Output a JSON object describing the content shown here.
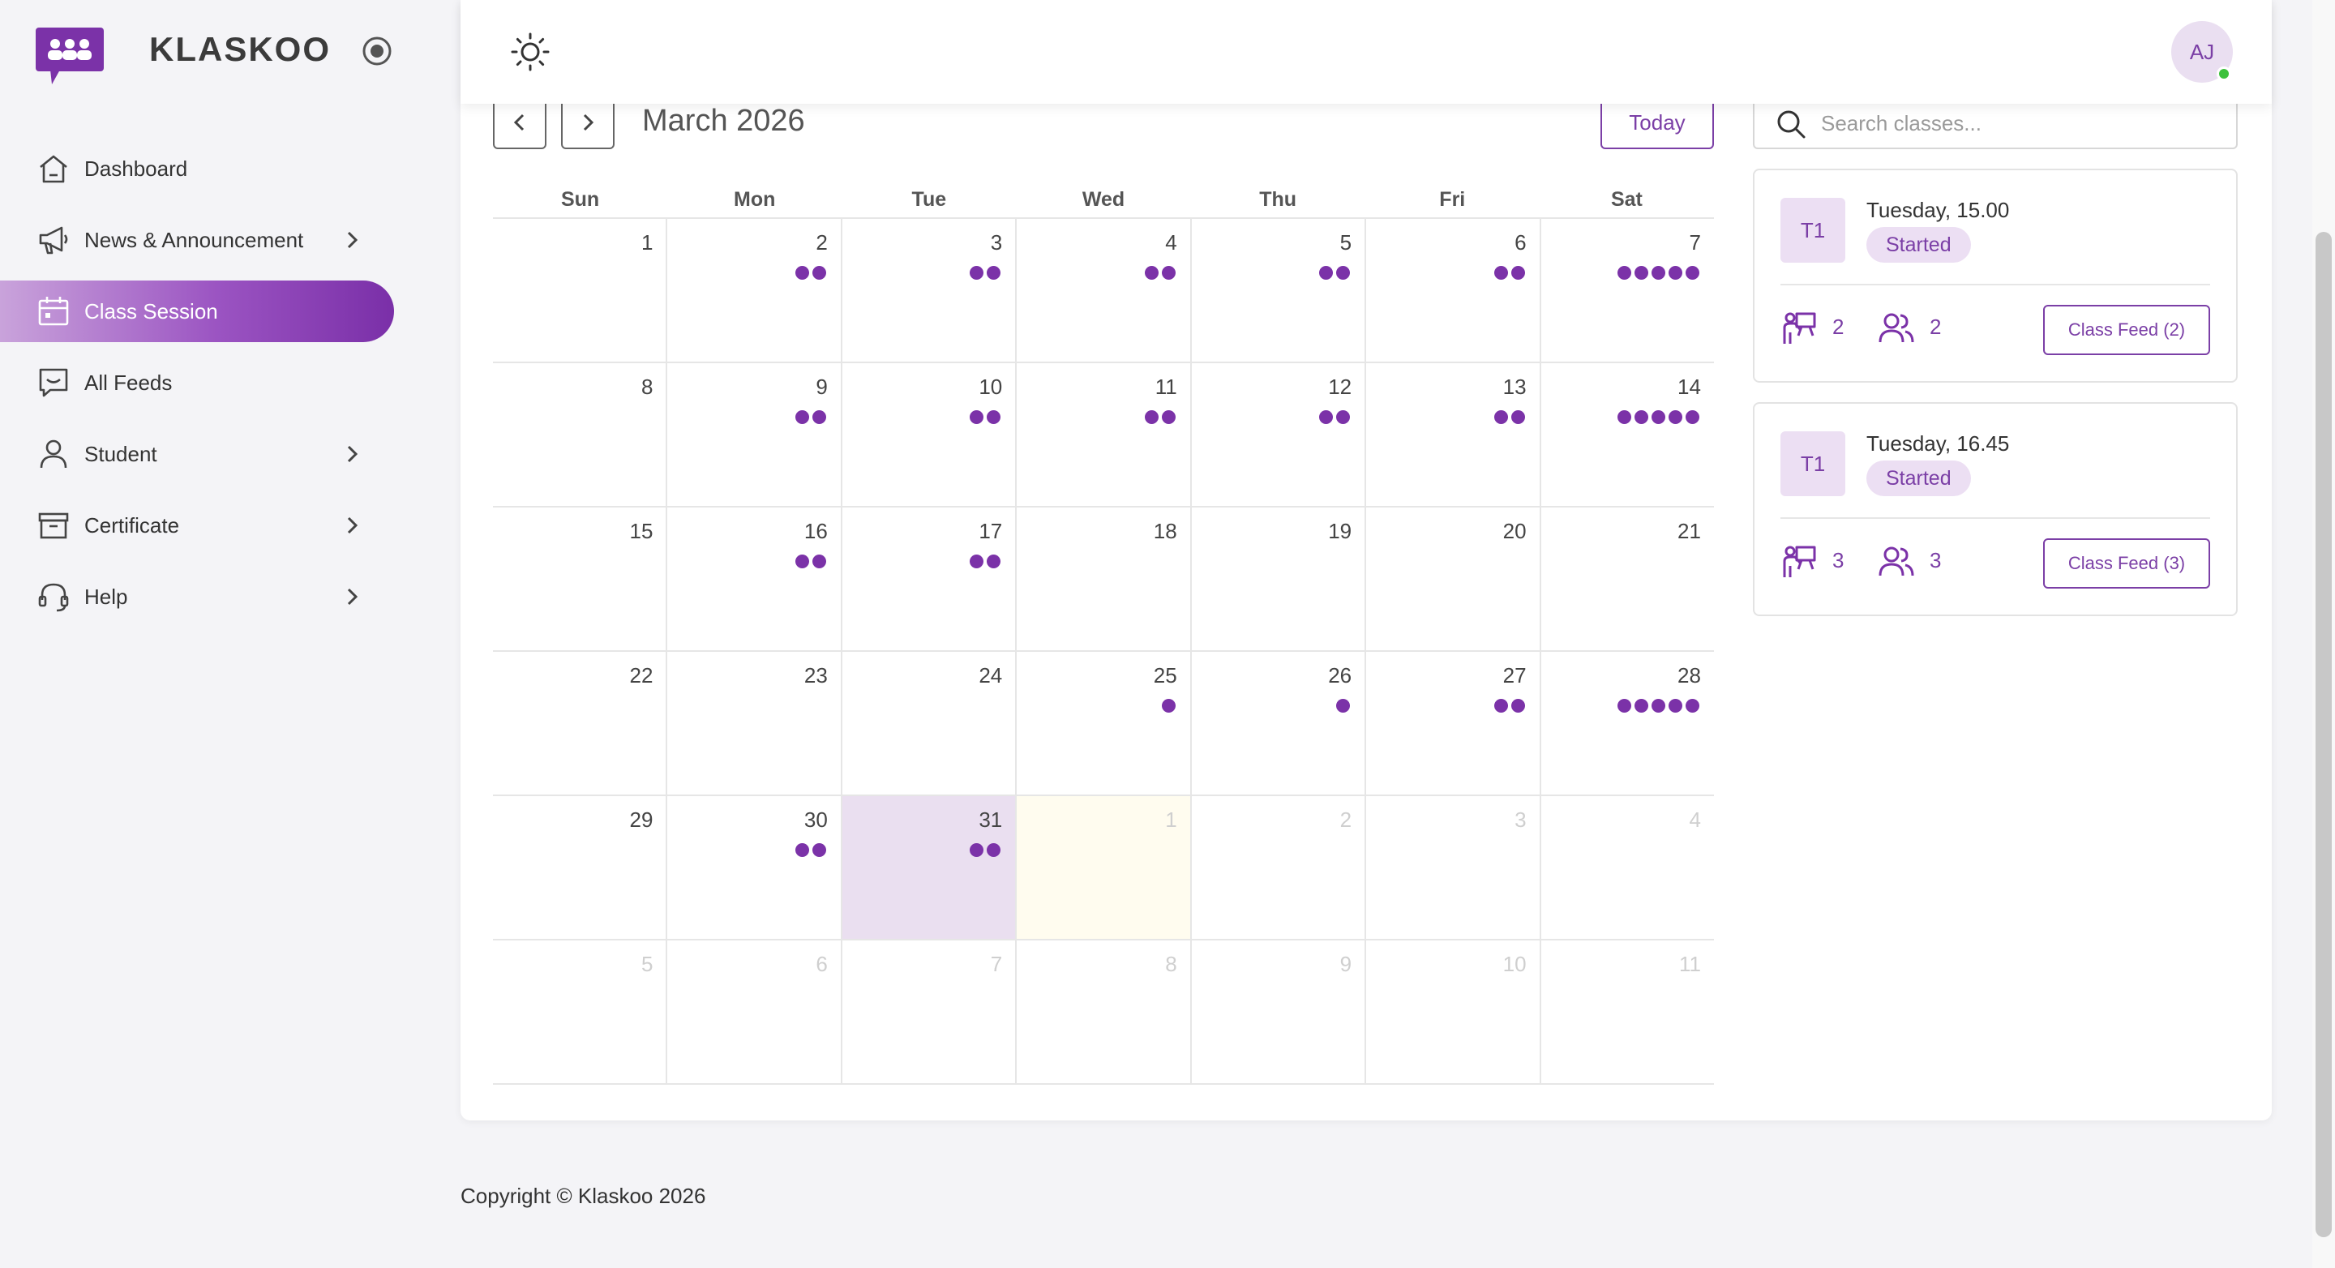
{
  "brand": {
    "name": "KLASKOO"
  },
  "colors": {
    "accent": "#7b32a8",
    "accent_light": "#ecdff3",
    "online": "#3cc13b"
  },
  "nav": {
    "dashboard": "Dashboard",
    "news": "News & Announcement",
    "class_session": "Class Session",
    "all_feeds": "All Feeds",
    "student": "Student",
    "certificate": "Certificate",
    "help": "Help"
  },
  "header": {
    "avatar_initials": "AJ"
  },
  "calendar": {
    "month_label": "March 2026",
    "today_label": "Today",
    "weekdays": [
      "Sun",
      "Mon",
      "Tue",
      "Wed",
      "Thu",
      "Fri",
      "Sat"
    ],
    "weeks": [
      [
        {
          "d": "1",
          "e": 0
        },
        {
          "d": "2",
          "e": 2
        },
        {
          "d": "3",
          "e": 2
        },
        {
          "d": "4",
          "e": 2
        },
        {
          "d": "5",
          "e": 2
        },
        {
          "d": "6",
          "e": 2
        },
        {
          "d": "7",
          "e": 5
        }
      ],
      [
        {
          "d": "8",
          "e": 0
        },
        {
          "d": "9",
          "e": 2
        },
        {
          "d": "10",
          "e": 2
        },
        {
          "d": "11",
          "e": 2
        },
        {
          "d": "12",
          "e": 2
        },
        {
          "d": "13",
          "e": 2
        },
        {
          "d": "14",
          "e": 5
        }
      ],
      [
        {
          "d": "15",
          "e": 0
        },
        {
          "d": "16",
          "e": 2
        },
        {
          "d": "17",
          "e": 2
        },
        {
          "d": "18",
          "e": 0
        },
        {
          "d": "19",
          "e": 0
        },
        {
          "d": "20",
          "e": 0
        },
        {
          "d": "21",
          "e": 0
        }
      ],
      [
        {
          "d": "22",
          "e": 0
        },
        {
          "d": "23",
          "e": 0
        },
        {
          "d": "24",
          "e": 0
        },
        {
          "d": "25",
          "e": 1
        },
        {
          "d": "26",
          "e": 1
        },
        {
          "d": "27",
          "e": 2
        },
        {
          "d": "28",
          "e": 5
        }
      ],
      [
        {
          "d": "29",
          "e": 0
        },
        {
          "d": "30",
          "e": 2
        },
        {
          "d": "31",
          "e": 2,
          "selected": true
        },
        {
          "d": "1",
          "e": 0,
          "other": true,
          "today": true
        },
        {
          "d": "2",
          "e": 0,
          "other": true
        },
        {
          "d": "3",
          "e": 0,
          "other": true
        },
        {
          "d": "4",
          "e": 0,
          "other": true
        }
      ],
      [
        {
          "d": "5",
          "e": 0,
          "other": true
        },
        {
          "d": "6",
          "e": 0,
          "other": true
        },
        {
          "d": "7",
          "e": 0,
          "other": true
        },
        {
          "d": "8",
          "e": 0,
          "other": true
        },
        {
          "d": "9",
          "e": 0,
          "other": true
        },
        {
          "d": "10",
          "e": 0,
          "other": true
        },
        {
          "d": "11",
          "e": 0,
          "other": true
        }
      ]
    ]
  },
  "search": {
    "placeholder": "Search classes..."
  },
  "sessions": [
    {
      "badge": "T1",
      "time": "Tuesday, 15.00",
      "status": "Started",
      "teachers": "2",
      "students": "2",
      "feed_label": "Class Feed (2)"
    },
    {
      "badge": "T1",
      "time": "Tuesday, 16.45",
      "status": "Started",
      "teachers": "3",
      "students": "3",
      "feed_label": "Class Feed (3)"
    }
  ],
  "footer": {
    "text": "Copyright © Klaskoo 2026"
  }
}
